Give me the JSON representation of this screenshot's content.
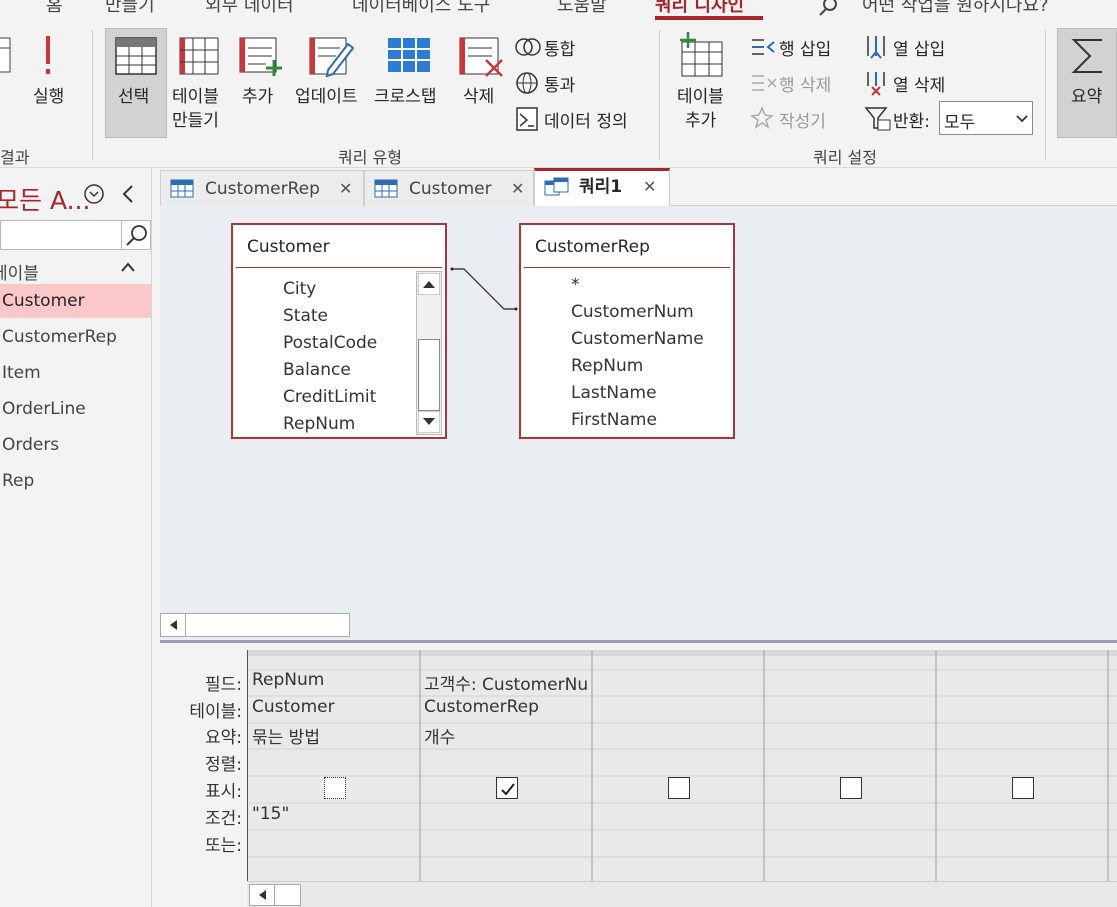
{
  "menu": {
    "items": [
      "홈",
      "만들기",
      "외부 데이터",
      "데이터베이스 도구",
      "도움말",
      "쿼리 디자인",
      "어떤 작업을 원하시나요?"
    ]
  },
  "ribbon": {
    "results_group": "결과",
    "run": "실행",
    "query_type_group": "쿼리 유형",
    "select": "선택",
    "make_table_1": "테이블",
    "make_table_2": "만들기",
    "append": "추가",
    "update": "업데이트",
    "crosstab": "크로스탭",
    "delete": "삭제",
    "union": "통합",
    "pass_through": "통과",
    "data_definition": "데이터 정의",
    "show_table_1": "테이블",
    "show_table_2": "추가",
    "insert_rows": "행 삽입",
    "delete_rows": "행 삭제",
    "builder": "작성기",
    "insert_columns": "열 삽입",
    "delete_columns": "열 삭제",
    "return_label": "반환:",
    "return_value": "모두",
    "query_setup_group": "쿼리 설정",
    "totals": "요약"
  },
  "nav": {
    "title": "모든 A...",
    "section": "테이블",
    "items": [
      "Customer",
      "CustomerRep",
      "Item",
      "OrderLine",
      "Orders",
      "Rep"
    ]
  },
  "tabs": [
    "CustomerRep",
    "Customer",
    "쿼리1"
  ],
  "tables": {
    "customer": {
      "title": "Customer",
      "fields": [
        "City",
        "State",
        "PostalCode",
        "Balance",
        "CreditLimit",
        "RepNum"
      ]
    },
    "customerrep": {
      "title": "CustomerRep",
      "fields": [
        "*",
        "CustomerNum",
        "CustomerName",
        "RepNum",
        "LastName",
        "FirstName"
      ]
    }
  },
  "grid": {
    "row_labels": [
      "필드:",
      "테이블:",
      "요약:",
      "정렬:",
      "표시:",
      "조건:",
      "또는:"
    ],
    "columns": [
      {
        "field": "RepNum",
        "table": "Customer",
        "total": "묶는 방법",
        "criteria": "\"15\"",
        "show": false
      },
      {
        "field": "고객수: CustomerNu",
        "table": "CustomerRep",
        "total": "개수",
        "criteria": "",
        "show": true
      },
      {
        "field": "",
        "table": "",
        "total": "",
        "criteria": "",
        "show": false
      },
      {
        "field": "",
        "table": "",
        "total": "",
        "criteria": "",
        "show": false
      },
      {
        "field": "",
        "table": "",
        "total": "",
        "criteria": "",
        "show": false
      }
    ]
  },
  "colors": {
    "accent": "#a4262c",
    "canvas": "#eaedf1",
    "selected_nav": "#fcc7c9"
  }
}
